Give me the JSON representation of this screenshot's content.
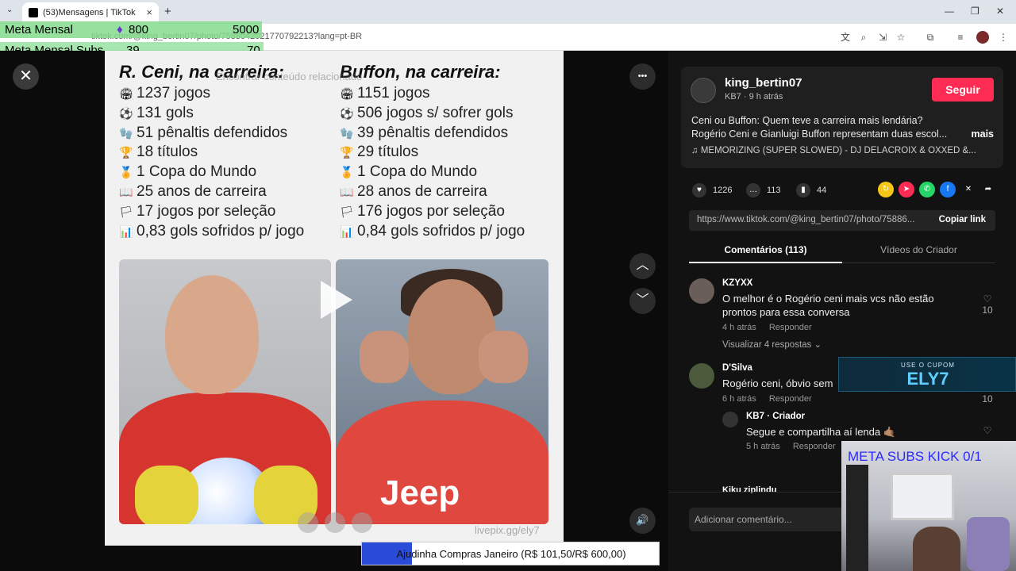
{
  "browser": {
    "tab_title": "(53)Mensagens | TikTok",
    "url": "tiktok.com/@king_bertin07/photo/7588042021770792213?lang=pt-BR",
    "new_tab": "+",
    "close_tab": "×",
    "minimize": "—",
    "restore": "❐",
    "close_window": "✕"
  },
  "overlay": {
    "meta_mensal_label": "Meta Mensal",
    "meta_mensal_gem": "800",
    "meta_mensal_goal": "5000",
    "meta_subs_label": "Meta Mensal Subs",
    "meta_subs_current": "39",
    "meta_subs_goal": "70"
  },
  "viewer": {
    "search_ghost": "Encontrar conteúdo relacionado",
    "left_title": "R. Ceni, na carreira:",
    "left_stats": [
      "1237 jogos",
      "131 gols",
      "51 pênaltis defendidos",
      "18 títulos",
      "1 Copa do Mundo",
      "25 anos de carreira",
      "17 jogos por seleção",
      "0,83 gols sofridos p/ jogo"
    ],
    "right_title": "Buffon, na carreira:",
    "right_stats": [
      "1151 jogos",
      "506 jogos s/ sofrer gols",
      "39 pênaltis defendidos",
      "29 títulos",
      "1 Copa do Mundo",
      "28 anos de carreira",
      "176 jogos por seleção",
      "0,84 gols sofridos p/ jogo"
    ],
    "stat_icons": [
      "🏟",
      "⚽",
      "🧤",
      "🏆",
      "🏅",
      "📖",
      "🏳",
      "📊"
    ],
    "jeep_text": "Jeep",
    "watermark": "livepix.gg/ely7",
    "close_icon": "✕",
    "more_icon": "•••",
    "up_icon": "︿",
    "down_icon": "﹀",
    "volume_icon": "🔊"
  },
  "panel": {
    "username": "king_bertin07",
    "subline": "KB7 · 9 h atrás",
    "follow": "Seguir",
    "desc_line1": "Ceni ou Buffon: Quem teve a carreira mais lendária?",
    "desc_line2": "Rogério Ceni e Gianluigi Buffon representam duas escol...",
    "desc_more": "mais",
    "music": "♫  MEMORIZING (SUPER SLOWED) - DJ DELACROIX & OXXED &...",
    "likes": "1226",
    "comments_count": "113",
    "saves": "44",
    "link": "https://www.tiktok.com/@king_bertin07/photo/75886...",
    "copy_link": "Copiar link",
    "tab_comments": "Comentários (113)",
    "tab_videos": "Vídeos do Criador",
    "comments": [
      {
        "name": "KZYXX",
        "text": "O melhor é o Rogério ceni mais vcs não estão prontos para essa conversa",
        "time": "4 h atrás",
        "reply": "Responder",
        "likes": "10"
      },
      {
        "name": "D'Silva",
        "text": "Rogério ceni, óbvio sem",
        "time": "6 h atrás",
        "reply": "Responder",
        "likes": "10"
      },
      {
        "name": "KB7 · Criador",
        "text": "Segue e compartilha aí lenda 🤙🏽",
        "time": "5 h atrás",
        "reply": "Responder",
        "likes": ""
      }
    ],
    "view_replies": "Visualizar 4 respostas ⌄",
    "partial_name": "Kiku ziplindu",
    "add_comment": "Adicionar comentário..."
  },
  "stream": {
    "coupon_top": "USE O CUPOM",
    "coupon_code": "ELY7",
    "cam_title": "META SUBS KICK 0/1",
    "progress_text": "Ajudinha Compras Janeiro (R$ 101,50/R$ 600,00)",
    "progress_fraction": 0.169
  },
  "colors": {
    "accent": "#fe2c55",
    "progress_fill": "#2a4ad8",
    "meta_green": "#82dc8c"
  }
}
